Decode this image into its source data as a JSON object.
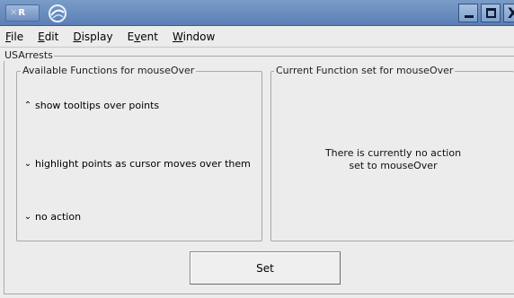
{
  "window": {
    "app_badge": "R",
    "close_glyph": "X",
    "colors": {
      "titlebar": "#6a8cc0",
      "pane": "#ececec",
      "border": "#a9a9a9"
    }
  },
  "menubar": {
    "items": [
      {
        "label": "File",
        "mnemonic": "F",
        "rest": "ile"
      },
      {
        "label": "Edit",
        "mnemonic": "E",
        "rest": "dit"
      },
      {
        "label": "Display",
        "mnemonic": "D",
        "rest": "isplay"
      },
      {
        "label": "Event",
        "pre": "E",
        "mnemonic": "v",
        "rest": "ent"
      },
      {
        "label": "Window",
        "mnemonic": "W",
        "rest": "indow"
      }
    ]
  },
  "frame": {
    "label": "USArrests"
  },
  "available": {
    "label": "Available Functions for mouseOver",
    "options": [
      {
        "label": "show tooltips over points",
        "icon": "chevron-up-icon"
      },
      {
        "label": "highlight points as cursor moves over them",
        "icon": "chevron-down-icon"
      },
      {
        "label": "no action",
        "icon": "chevron-down-icon"
      }
    ]
  },
  "current": {
    "label": "Current Function set for mouseOver",
    "message_line1": "There is currently no action",
    "message_line2": "set to mouseOver"
  },
  "set_button": {
    "label": "Set"
  }
}
